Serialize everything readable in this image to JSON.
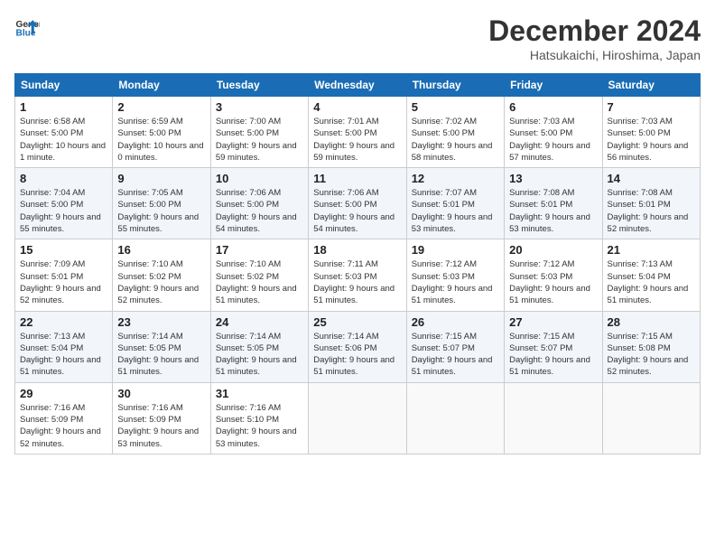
{
  "header": {
    "logo_line1": "General",
    "logo_line2": "Blue",
    "month": "December 2024",
    "location": "Hatsukaichi, Hiroshima, Japan"
  },
  "weekdays": [
    "Sunday",
    "Monday",
    "Tuesday",
    "Wednesday",
    "Thursday",
    "Friday",
    "Saturday"
  ],
  "weeks": [
    [
      {
        "day": "1",
        "sunrise": "6:58 AM",
        "sunset": "5:00 PM",
        "daylight": "10 hours and 1 minute."
      },
      {
        "day": "2",
        "sunrise": "6:59 AM",
        "sunset": "5:00 PM",
        "daylight": "10 hours and 0 minutes."
      },
      {
        "day": "3",
        "sunrise": "7:00 AM",
        "sunset": "5:00 PM",
        "daylight": "9 hours and 59 minutes."
      },
      {
        "day": "4",
        "sunrise": "7:01 AM",
        "sunset": "5:00 PM",
        "daylight": "9 hours and 59 minutes."
      },
      {
        "day": "5",
        "sunrise": "7:02 AM",
        "sunset": "5:00 PM",
        "daylight": "9 hours and 58 minutes."
      },
      {
        "day": "6",
        "sunrise": "7:03 AM",
        "sunset": "5:00 PM",
        "daylight": "9 hours and 57 minutes."
      },
      {
        "day": "7",
        "sunrise": "7:03 AM",
        "sunset": "5:00 PM",
        "daylight": "9 hours and 56 minutes."
      }
    ],
    [
      {
        "day": "8",
        "sunrise": "7:04 AM",
        "sunset": "5:00 PM",
        "daylight": "9 hours and 55 minutes."
      },
      {
        "day": "9",
        "sunrise": "7:05 AM",
        "sunset": "5:00 PM",
        "daylight": "9 hours and 55 minutes."
      },
      {
        "day": "10",
        "sunrise": "7:06 AM",
        "sunset": "5:00 PM",
        "daylight": "9 hours and 54 minutes."
      },
      {
        "day": "11",
        "sunrise": "7:06 AM",
        "sunset": "5:00 PM",
        "daylight": "9 hours and 54 minutes."
      },
      {
        "day": "12",
        "sunrise": "7:07 AM",
        "sunset": "5:01 PM",
        "daylight": "9 hours and 53 minutes."
      },
      {
        "day": "13",
        "sunrise": "7:08 AM",
        "sunset": "5:01 PM",
        "daylight": "9 hours and 53 minutes."
      },
      {
        "day": "14",
        "sunrise": "7:08 AM",
        "sunset": "5:01 PM",
        "daylight": "9 hours and 52 minutes."
      }
    ],
    [
      {
        "day": "15",
        "sunrise": "7:09 AM",
        "sunset": "5:01 PM",
        "daylight": "9 hours and 52 minutes."
      },
      {
        "day": "16",
        "sunrise": "7:10 AM",
        "sunset": "5:02 PM",
        "daylight": "9 hours and 52 minutes."
      },
      {
        "day": "17",
        "sunrise": "7:10 AM",
        "sunset": "5:02 PM",
        "daylight": "9 hours and 51 minutes."
      },
      {
        "day": "18",
        "sunrise": "7:11 AM",
        "sunset": "5:03 PM",
        "daylight": "9 hours and 51 minutes."
      },
      {
        "day": "19",
        "sunrise": "7:12 AM",
        "sunset": "5:03 PM",
        "daylight": "9 hours and 51 minutes."
      },
      {
        "day": "20",
        "sunrise": "7:12 AM",
        "sunset": "5:03 PM",
        "daylight": "9 hours and 51 minutes."
      },
      {
        "day": "21",
        "sunrise": "7:13 AM",
        "sunset": "5:04 PM",
        "daylight": "9 hours and 51 minutes."
      }
    ],
    [
      {
        "day": "22",
        "sunrise": "7:13 AM",
        "sunset": "5:04 PM",
        "daylight": "9 hours and 51 minutes."
      },
      {
        "day": "23",
        "sunrise": "7:14 AM",
        "sunset": "5:05 PM",
        "daylight": "9 hours and 51 minutes."
      },
      {
        "day": "24",
        "sunrise": "7:14 AM",
        "sunset": "5:05 PM",
        "daylight": "9 hours and 51 minutes."
      },
      {
        "day": "25",
        "sunrise": "7:14 AM",
        "sunset": "5:06 PM",
        "daylight": "9 hours and 51 minutes."
      },
      {
        "day": "26",
        "sunrise": "7:15 AM",
        "sunset": "5:07 PM",
        "daylight": "9 hours and 51 minutes."
      },
      {
        "day": "27",
        "sunrise": "7:15 AM",
        "sunset": "5:07 PM",
        "daylight": "9 hours and 51 minutes."
      },
      {
        "day": "28",
        "sunrise": "7:15 AM",
        "sunset": "5:08 PM",
        "daylight": "9 hours and 52 minutes."
      }
    ],
    [
      {
        "day": "29",
        "sunrise": "7:16 AM",
        "sunset": "5:09 PM",
        "daylight": "9 hours and 52 minutes."
      },
      {
        "day": "30",
        "sunrise": "7:16 AM",
        "sunset": "5:09 PM",
        "daylight": "9 hours and 53 minutes."
      },
      {
        "day": "31",
        "sunrise": "7:16 AM",
        "sunset": "5:10 PM",
        "daylight": "9 hours and 53 minutes."
      },
      null,
      null,
      null,
      null
    ]
  ],
  "labels": {
    "sunrise": "Sunrise:",
    "sunset": "Sunset:",
    "daylight": "Daylight:"
  }
}
